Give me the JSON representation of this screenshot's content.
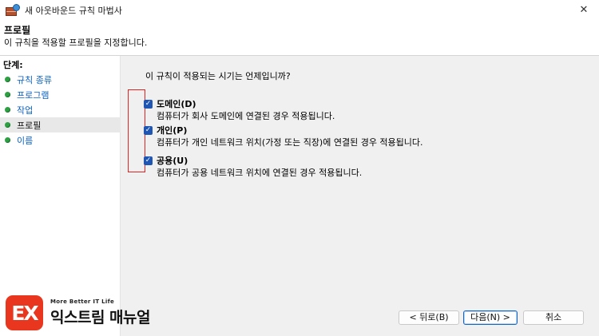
{
  "window": {
    "title": "새 아웃바운드 규칙 마법사",
    "close_glyph": "✕"
  },
  "header": {
    "title": "프로필",
    "description": "이 규칙을 적용할 프로필을 지정합니다."
  },
  "sidebar": {
    "label": "단계:",
    "items": [
      {
        "label": "규칙 종류"
      },
      {
        "label": "프로그램"
      },
      {
        "label": "작업"
      },
      {
        "label": "프로필",
        "current": true
      },
      {
        "label": "이름"
      }
    ]
  },
  "main": {
    "question": "이 규칙이 적용되는 시기는 언제입니까?",
    "options": [
      {
        "title": "도메인(D)",
        "description": "컴퓨터가 회사 도메인에 연결된 경우 적용됩니다.",
        "checked": true
      },
      {
        "title": "개인(P)",
        "description": "컴퓨터가 개인 네트워크 위치(가정 또는 직장)에 연결된 경우 적용됩니다.",
        "checked": true
      },
      {
        "title": "공용(U)",
        "description": "컴퓨터가 공용 네트워크 위치에 연결된 경우 적용됩니다.",
        "checked": true
      }
    ],
    "highlight_color": "#e02424"
  },
  "buttons": {
    "back": "< 뒤로(B)",
    "next": "다음(N) >",
    "cancel": "취소"
  },
  "watermark": {
    "logo_text": "EX",
    "tagline": "More Better IT Life",
    "brand": "익스트림 매뉴얼",
    "logo_color": "#e8371e"
  },
  "icons": {
    "app": "firewall-icon",
    "check": "checkmark-icon",
    "step": "green-dot-icon"
  }
}
